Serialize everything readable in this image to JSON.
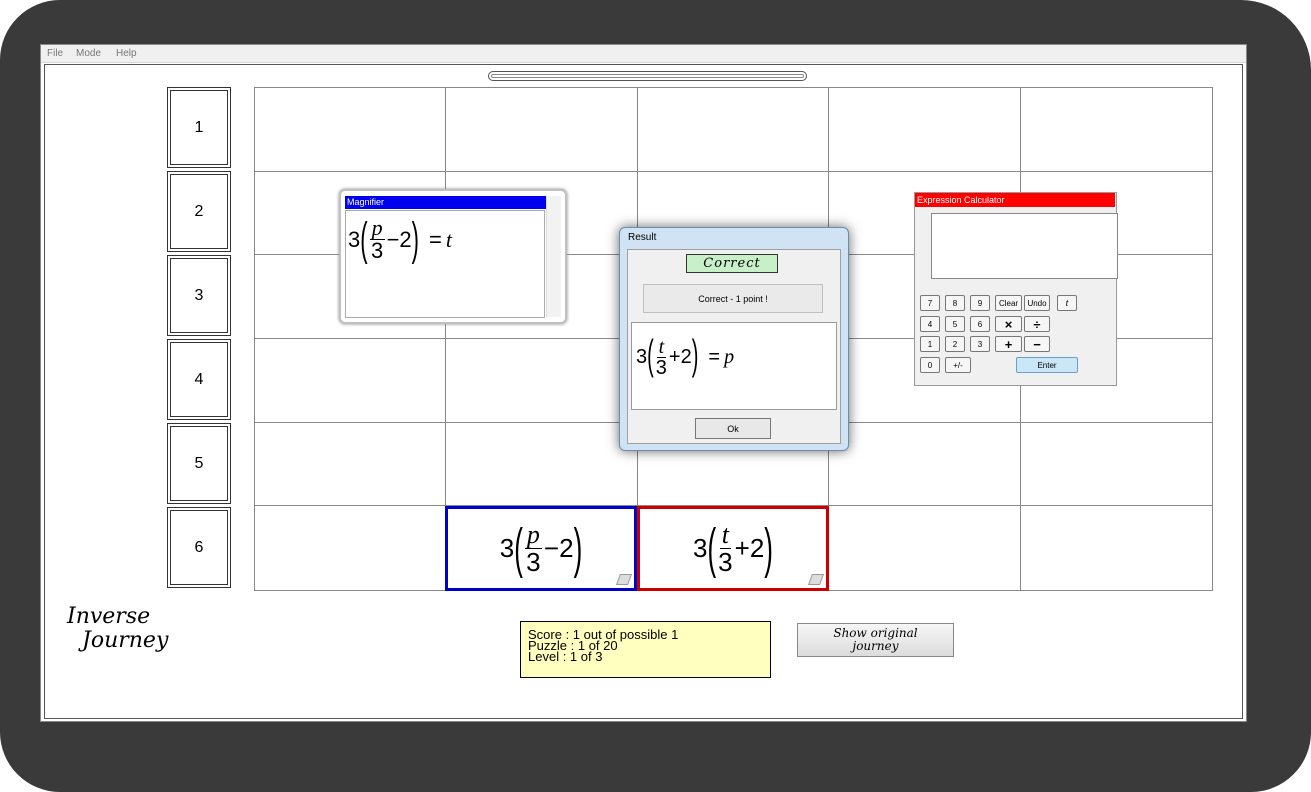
{
  "menubar": {
    "items": [
      "File",
      "Mode",
      "Help"
    ]
  },
  "row_labels": [
    "1",
    "2",
    "3",
    "4",
    "5",
    "6"
  ],
  "pieces": [
    {
      "coef": "3",
      "frac_num": "p",
      "frac_den": "3",
      "op_const": "−2",
      "border_color": "#0000cc"
    },
    {
      "coef": "3",
      "frac_num": "t",
      "frac_den": "3",
      "op_const": "+2",
      "border_color": "#cc0000"
    }
  ],
  "magnifier": {
    "title": "Magnifier",
    "coef": "3",
    "frac_num": "p",
    "frac_den": "3",
    "op_const": "−2",
    "equals": "=",
    "rhs": "t",
    "title_color": "#0000f0"
  },
  "result": {
    "title": "Result",
    "badge": "Correct",
    "message": "Correct - 1 point !",
    "coef": "3",
    "frac_num": "t",
    "frac_den": "3",
    "op_const": "+2",
    "equals": "=",
    "rhs": "p",
    "ok_label": "Ok"
  },
  "calculator": {
    "title": "Expression Calculator",
    "title_color": "#ff0000",
    "display_value": "",
    "buttons": {
      "b7": "7",
      "b8": "8",
      "b9": "9",
      "clear": "Clear",
      "undo": "Undo",
      "var_t": "t",
      "b4": "4",
      "b5": "5",
      "b6": "6",
      "times": "×",
      "divide": "÷",
      "b1": "1",
      "b2": "2",
      "b3": "3",
      "plus": "+",
      "minus": "−",
      "b0": "0",
      "plusminus": "+/-",
      "enter": "Enter"
    }
  },
  "mode_title": {
    "line1": "Inverse",
    "line2": "Journey"
  },
  "score_panel": {
    "score": "Score  : 1 out of possible 1",
    "puzzle": "Puzzle : 1 of 20",
    "level": "Level   : 1 of 3"
  },
  "show_original_button": {
    "line1": "Show original",
    "line2": "journey"
  }
}
